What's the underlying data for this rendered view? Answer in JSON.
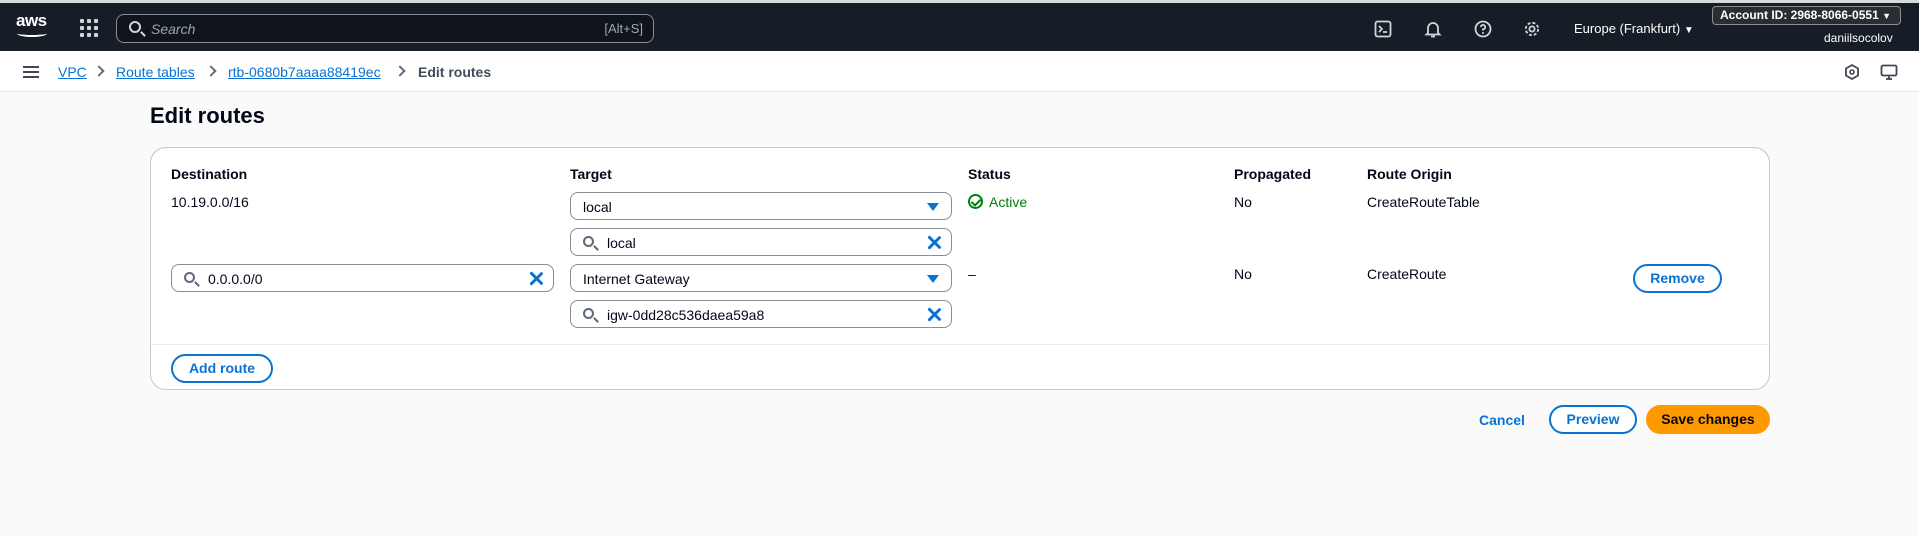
{
  "topnav": {
    "logo": "aws",
    "search_placeholder": "Search",
    "search_shortcut": "[Alt+S]",
    "region": "Europe (Frankfurt)",
    "account_id": "Account ID: 2968-8066-0551",
    "username": "daniilsocolov",
    "icons": [
      "cloudshell-icon",
      "bell-icon",
      "help-icon",
      "gear-icon"
    ]
  },
  "breadcrumb": {
    "items": [
      "VPC",
      "Route tables",
      "rtb-0680b7aaaa88419ec"
    ],
    "current": "Edit routes"
  },
  "page": {
    "title": "Edit routes"
  },
  "table": {
    "columns": [
      "Destination",
      "Target",
      "Status",
      "Propagated",
      "Route Origin"
    ],
    "rows": [
      {
        "destination": "10.19.0.0/16",
        "target_type": "local",
        "target_value": "local",
        "status": "Active",
        "propagated": "No",
        "origin": "CreateRouteTable"
      },
      {
        "destination": "0.0.0.0/0",
        "target_type": "Internet Gateway",
        "target_value": "igw-0dd28c536daea59a8",
        "status": "–",
        "propagated": "No",
        "origin": "CreateRoute",
        "remove_label": "Remove"
      }
    ],
    "add_route_label": "Add route"
  },
  "actions": {
    "cancel": "Cancel",
    "preview": "Preview",
    "save": "Save changes"
  },
  "colors": {
    "accent": "#0972d3",
    "primary": "#ff9900",
    "success": "#037f0c",
    "nav_bg": "#161d26"
  }
}
